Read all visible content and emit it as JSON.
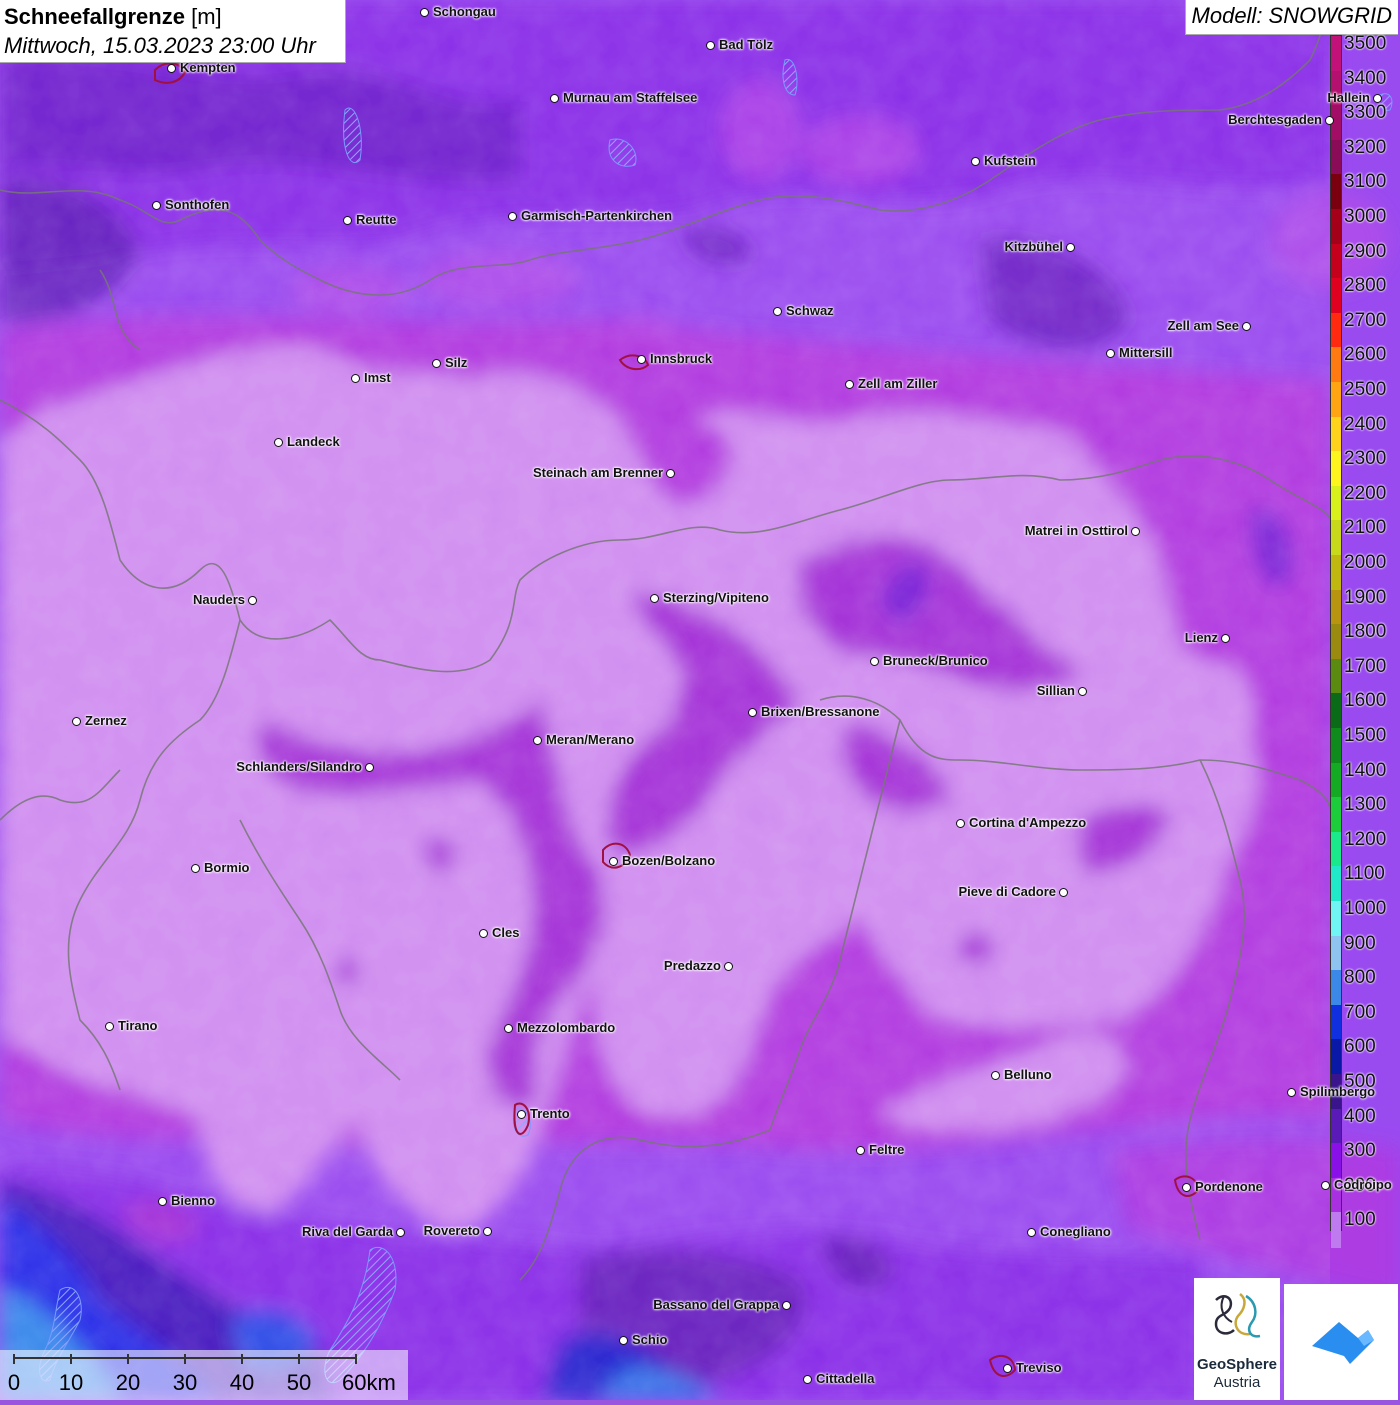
{
  "title": {
    "main": "Schneefallgrenze",
    "unit": "[m]",
    "datetime": "Mittwoch, 15.03.2023 23:00 Uhr"
  },
  "model": "Modell: SNOWGRID",
  "legend": {
    "ticks": [
      {
        "label": "3500",
        "color": "#c2127a"
      },
      {
        "label": "3400",
        "color": "#b3106f"
      },
      {
        "label": "3300",
        "color": "#a20e66"
      },
      {
        "label": "3200",
        "color": "#8a0b57"
      },
      {
        "label": "3100",
        "color": "#7a0010"
      },
      {
        "label": "3000",
        "color": "#a5001a"
      },
      {
        "label": "2900",
        "color": "#c4001c"
      },
      {
        "label": "2800",
        "color": "#e0001f"
      },
      {
        "label": "2700",
        "color": "#ff2a10"
      },
      {
        "label": "2600",
        "color": "#ff7a10"
      },
      {
        "label": "2500",
        "color": "#ffa514"
      },
      {
        "label": "2400",
        "color": "#ffd21c"
      },
      {
        "label": "2300",
        "color": "#fff51e"
      },
      {
        "label": "2200",
        "color": "#d8f01c"
      },
      {
        "label": "2100",
        "color": "#c8d81a"
      },
      {
        "label": "2000",
        "color": "#c0b810"
      },
      {
        "label": "1900",
        "color": "#b89410"
      },
      {
        "label": "1800",
        "color": "#9a8a10"
      },
      {
        "label": "1700",
        "color": "#5a8a10"
      },
      {
        "label": "1600",
        "color": "#0a6a18"
      },
      {
        "label": "1500",
        "color": "#0f8a1c"
      },
      {
        "label": "1400",
        "color": "#14aa24"
      },
      {
        "label": "1300",
        "color": "#1ccc3a"
      },
      {
        "label": "1200",
        "color": "#1ae88a"
      },
      {
        "label": "1100",
        "color": "#20e8c8"
      },
      {
        "label": "1000",
        "color": "#70f4f4"
      },
      {
        "label": "900",
        "color": "#90c4f0"
      },
      {
        "label": "800",
        "color": "#3c88e8"
      },
      {
        "label": "700",
        "color": "#1030e0"
      },
      {
        "label": "600",
        "color": "#0a18a8"
      },
      {
        "label": "500",
        "color": "#3a148c"
      },
      {
        "label": "400",
        "color": "#5a1ab8"
      },
      {
        "label": "300",
        "color": "#8a10e8"
      },
      {
        "label": "200",
        "color": "#a830e0"
      },
      {
        "label": "100",
        "color": "#c07af0"
      }
    ]
  },
  "cities": [
    {
      "name": "Schongau",
      "label_side": "right"
    },
    {
      "name": "Bad Tölz",
      "label_side": "right"
    },
    {
      "name": "Kempten",
      "label_side": "right"
    },
    {
      "name": "Murnau am Staffelsee",
      "label_side": "right"
    },
    {
      "name": "Hallein",
      "label_side": "left"
    },
    {
      "name": "Berchtesgaden",
      "label_side": "left"
    },
    {
      "name": "Kufstein",
      "label_side": "right"
    },
    {
      "name": "Sonthofen",
      "label_side": "right"
    },
    {
      "name": "Reutte",
      "label_side": "right"
    },
    {
      "name": "Garmisch-Partenkirchen",
      "label_side": "right"
    },
    {
      "name": "Kitzbühel",
      "label_side": "left"
    },
    {
      "name": "Schwaz",
      "label_side": "right"
    },
    {
      "name": "Zell am See",
      "label_side": "left"
    },
    {
      "name": "Mittersill",
      "label_side": "right"
    },
    {
      "name": "Innsbruck",
      "label_side": "right"
    },
    {
      "name": "Silz",
      "label_side": "right"
    },
    {
      "name": "Imst",
      "label_side": "right"
    },
    {
      "name": "Zell am Ziller",
      "label_side": "right"
    },
    {
      "name": "Landeck",
      "label_side": "right"
    },
    {
      "name": "Steinach am Brenner",
      "label_side": "left"
    },
    {
      "name": "Matrei in Osttirol",
      "label_side": "left"
    },
    {
      "name": "Nauders",
      "label_side": "left"
    },
    {
      "name": "Sterzing/Vipiteno",
      "label_side": "right"
    },
    {
      "name": "Lienz",
      "label_side": "left"
    },
    {
      "name": "Bruneck/Brunico",
      "label_side": "right"
    },
    {
      "name": "Sillian",
      "label_side": "left"
    },
    {
      "name": "Brixen/Bressanone",
      "label_side": "right"
    },
    {
      "name": "Zernez",
      "label_side": "right"
    },
    {
      "name": "Meran/Merano",
      "label_side": "right"
    },
    {
      "name": "Schlanders/Silandro",
      "label_side": "left"
    },
    {
      "name": "Cortina d'Ampezzo",
      "label_side": "right"
    },
    {
      "name": "Bozen/Bolzano",
      "label_side": "right"
    },
    {
      "name": "Bormio",
      "label_side": "right"
    },
    {
      "name": "Pieve di Cadore",
      "label_side": "left"
    },
    {
      "name": "Cles",
      "label_side": "right"
    },
    {
      "name": "Predazzo",
      "label_side": "left"
    },
    {
      "name": "Tirano",
      "label_side": "right"
    },
    {
      "name": "Mezzolombardo",
      "label_side": "right"
    },
    {
      "name": "Belluno",
      "label_side": "right"
    },
    {
      "name": "Spilimbergo",
      "label_side": "right"
    },
    {
      "name": "Trento",
      "label_side": "right"
    },
    {
      "name": "Feltre",
      "label_side": "right"
    },
    {
      "name": "Pordenone",
      "label_side": "right"
    },
    {
      "name": "Codroipo",
      "label_side": "right"
    },
    {
      "name": "Bienno",
      "label_side": "right"
    },
    {
      "name": "Riva del Garda",
      "label_side": "left"
    },
    {
      "name": "Rovereto",
      "label_side": "left"
    },
    {
      "name": "Conegliano",
      "label_side": "right"
    },
    {
      "name": "Bassano del Grappa",
      "label_side": "left"
    },
    {
      "name": "Schio",
      "label_side": "right"
    },
    {
      "name": "Treviso",
      "label_side": "right"
    },
    {
      "name": "Cittadella",
      "label_side": "right"
    }
  ],
  "scale": {
    "labels": [
      "0",
      "10",
      "20",
      "30",
      "40",
      "50",
      "60km"
    ]
  },
  "logos": {
    "geosphere_line1": "GeoSphere",
    "geosphere_line2": "Austria"
  }
}
